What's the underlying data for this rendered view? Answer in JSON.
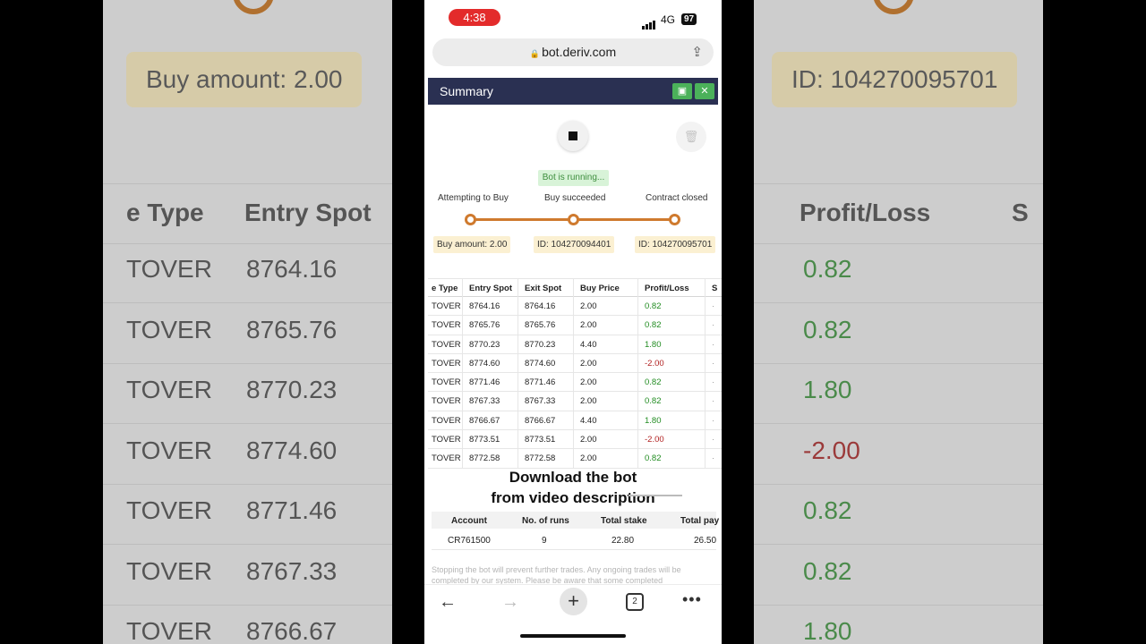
{
  "status": {
    "time": "4:38",
    "network": "4G",
    "battery": "97"
  },
  "browser": {
    "url": "bot.deriv.com"
  },
  "summary": {
    "title": "Summary"
  },
  "bot_status": "Bot is running...",
  "steps": [
    "Attempting to Buy",
    "Buy succeeded",
    "Contract closed"
  ],
  "badges": [
    "Buy amount: 2.00",
    "ID: 104270094401",
    "ID: 104270095701"
  ],
  "transactions": {
    "headers": [
      "e Type",
      "Entry Spot",
      "Exit Spot",
      "Buy Price",
      "Profit/Loss",
      "S"
    ],
    "rows": [
      {
        "type": "TOVER",
        "entry": "8764.16",
        "exit": "8764.16",
        "buy": "2.00",
        "pl": "0.82"
      },
      {
        "type": "TOVER",
        "entry": "8765.76",
        "exit": "8765.76",
        "buy": "2.00",
        "pl": "0.82"
      },
      {
        "type": "TOVER",
        "entry": "8770.23",
        "exit": "8770.23",
        "buy": "4.40",
        "pl": "1.80"
      },
      {
        "type": "TOVER",
        "entry": "8774.60",
        "exit": "8774.60",
        "buy": "2.00",
        "pl": "-2.00"
      },
      {
        "type": "TOVER",
        "entry": "8771.46",
        "exit": "8771.46",
        "buy": "2.00",
        "pl": "0.82"
      },
      {
        "type": "TOVER",
        "entry": "8767.33",
        "exit": "8767.33",
        "buy": "2.00",
        "pl": "0.82"
      },
      {
        "type": "TOVER",
        "entry": "8766.67",
        "exit": "8766.67",
        "buy": "4.40",
        "pl": "1.80"
      },
      {
        "type": "TOVER",
        "entry": "8773.51",
        "exit": "8773.51",
        "buy": "2.00",
        "pl": "-2.00"
      },
      {
        "type": "TOVER",
        "entry": "8772.58",
        "exit": "8772.58",
        "buy": "2.00",
        "pl": "0.82"
      }
    ]
  },
  "overlay": {
    "line1": "Download the bot",
    "line2": "from video description"
  },
  "stats": {
    "headers": [
      "Account",
      "No. of runs",
      "Total stake",
      "Total pay"
    ],
    "values": [
      "CR761500",
      "9",
      "22.80",
      "26.50"
    ]
  },
  "note": "Stopping the bot will prevent further trades. Any ongoing trades will be completed by our system. Please be aware that some completed",
  "nav": {
    "tab_count": "2"
  },
  "background": {
    "left_badge": "Buy amount: 2.00",
    "right_badge": "ID: 104270095701",
    "left_headers": [
      "e Type",
      "Entry Spot"
    ],
    "right_headers": [
      "Profit/Loss",
      "S"
    ],
    "left_rows": [
      [
        "TOVER",
        "8764.16"
      ],
      [
        "TOVER",
        "8765.76"
      ],
      [
        "TOVER",
        "8770.23"
      ],
      [
        "TOVER",
        "8774.60"
      ],
      [
        "TOVER",
        "8771.46"
      ],
      [
        "TOVER",
        "8767.33"
      ],
      [
        "TOVER",
        "8766.67"
      ]
    ],
    "right_rows": [
      "0.82",
      "0.82",
      "1.80",
      "-2.00",
      "0.82",
      "0.82",
      "1.80"
    ]
  },
  "colors": {
    "header_bg": "#2a3052",
    "accent_orange": "#cf7a2e",
    "profit": "#218c21",
    "loss": "#b22222",
    "save_green": "#4bb15a"
  }
}
